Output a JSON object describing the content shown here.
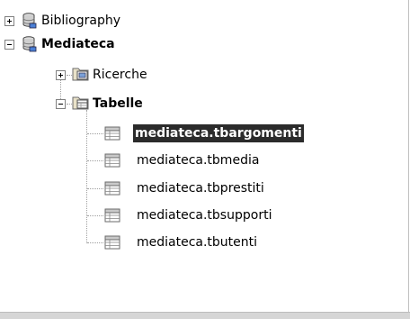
{
  "tree": {
    "roots": [
      {
        "label": "Bibliography",
        "icon": "database-icon",
        "expanded": false,
        "bold": false
      },
      {
        "label": "Mediateca",
        "icon": "database-icon",
        "expanded": true,
        "bold": true,
        "children": [
          {
            "label": "Ricerche",
            "icon": "queries-folder-icon",
            "expanded": false
          },
          {
            "label": "Tabelle",
            "icon": "tables-folder-icon",
            "expanded": true,
            "bold": true,
            "children": [
              {
                "label": "mediateca.tbargomenti",
                "icon": "table-icon",
                "selected": true
              },
              {
                "label": "mediateca.tbmedia",
                "icon": "table-icon"
              },
              {
                "label": "mediateca.tbprestiti",
                "icon": "table-icon"
              },
              {
                "label": "mediateca.tbsupporti",
                "icon": "table-icon"
              },
              {
                "label": "mediateca.tbutenti",
                "icon": "table-icon"
              }
            ]
          }
        ]
      }
    ]
  },
  "colors": {
    "selection_bg": "#2b2b2b",
    "selection_fg": "#ffffff",
    "status_strip": "#d6d6d6"
  }
}
